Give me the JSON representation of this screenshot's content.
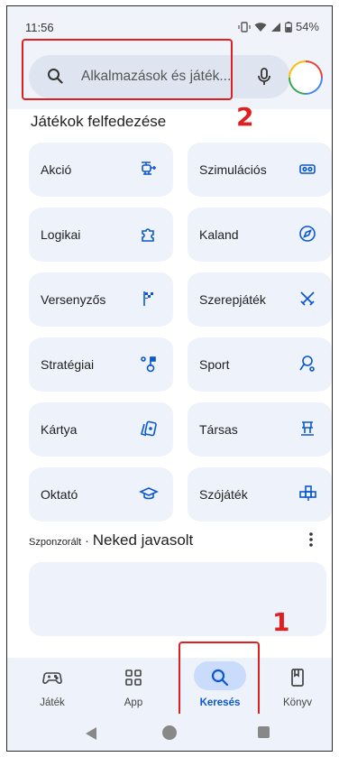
{
  "status_bar": {
    "time": "11:56",
    "battery": "54%"
  },
  "search": {
    "placeholder": "Alkalmazások és játék..."
  },
  "annotations": {
    "search_number": "2",
    "nav_number": "1"
  },
  "section_title": "Játékok felfedezése",
  "categories": [
    {
      "label": "Akció",
      "icon": "helicopter-icon"
    },
    {
      "label": "Szimulációs",
      "icon": "vr-headset-icon"
    },
    {
      "label": "Logikai",
      "icon": "puzzle-icon"
    },
    {
      "label": "Kaland",
      "icon": "compass-icon"
    },
    {
      "label": "Versenyzős",
      "icon": "checkered-flag-icon"
    },
    {
      "label": "Szerepjáték",
      "icon": "crossed-swords-icon"
    },
    {
      "label": "Stratégiai",
      "icon": "strategy-icon"
    },
    {
      "label": "Sport",
      "icon": "whistle-icon"
    },
    {
      "label": "Kártya",
      "icon": "cards-icon"
    },
    {
      "label": "Társas",
      "icon": "board-game-icon"
    },
    {
      "label": "Oktató",
      "icon": "graduation-cap-icon"
    },
    {
      "label": "Szójáték",
      "icon": "word-blocks-icon"
    }
  ],
  "sponsored": {
    "label": "Szponzorált",
    "separator": "·",
    "title": "Neked javasolt"
  },
  "bottom_nav": [
    {
      "label": "Játék",
      "icon": "gamepad-icon",
      "active": false
    },
    {
      "label": "App",
      "icon": "apps-grid-icon",
      "active": false
    },
    {
      "label": "Keresés",
      "icon": "search-icon",
      "active": true
    },
    {
      "label": "Könyv",
      "icon": "book-icon",
      "active": false
    }
  ],
  "colors": {
    "accent": "#0b57d0",
    "annotation": "#e02020",
    "tile_bg": "#eef2fa"
  }
}
